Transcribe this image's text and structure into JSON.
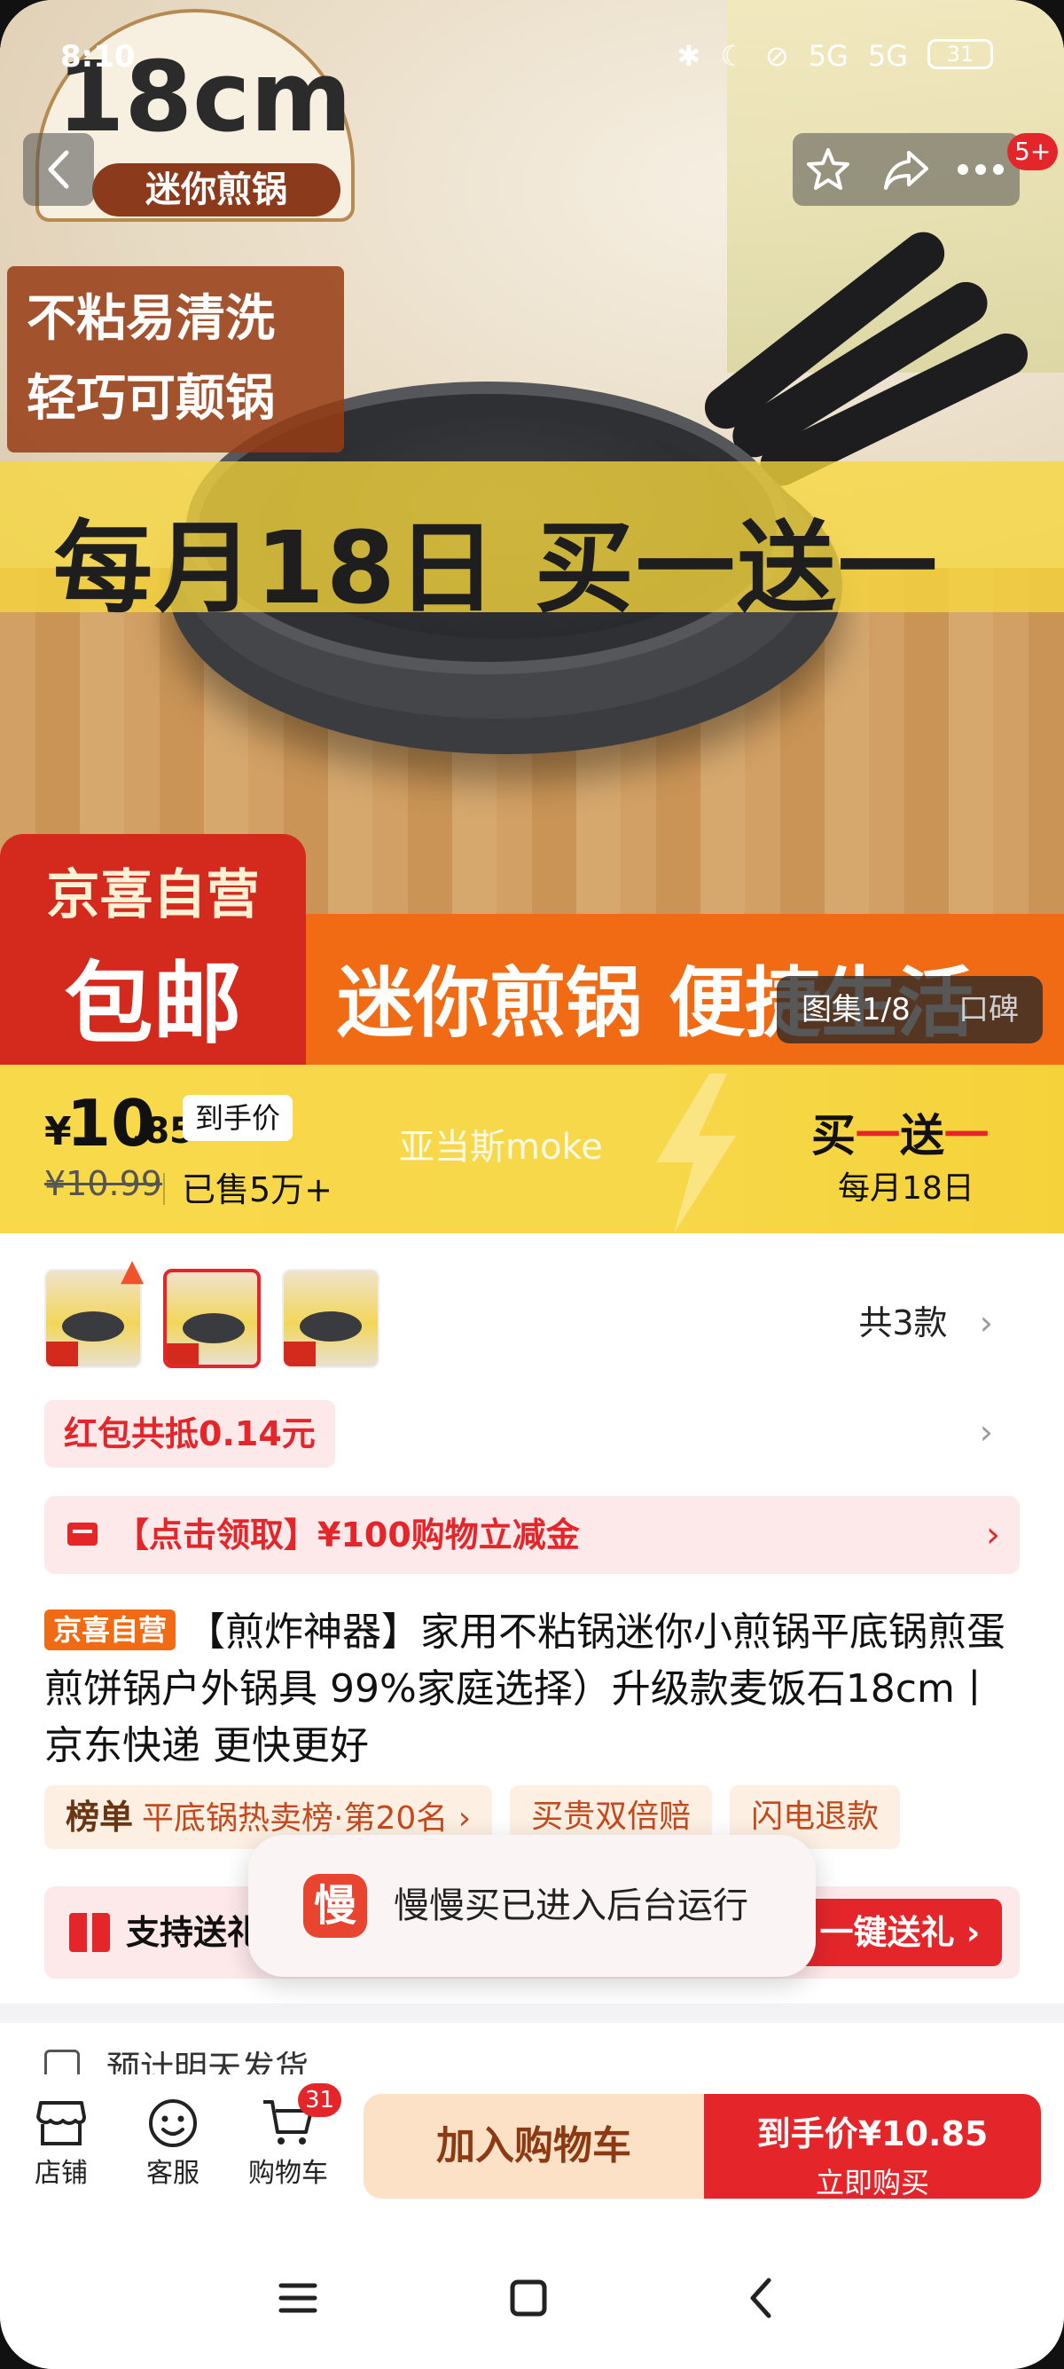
{
  "status_bar": {
    "time": "8:10",
    "signal_1": "5G",
    "signal_2": "5G",
    "battery": "31"
  },
  "hero": {
    "size_big": "18cm",
    "size_label": "迷你煎锅",
    "feature_1": "不粘易清洗",
    "feature_2": "轻巧可颠锅",
    "promo_band": "每月18日 买一送一",
    "brand_badge_1": "京喜自营",
    "brand_badge_2": "包邮",
    "orange_slogan": "迷你煎锅 便捷生活",
    "gallery_label": "图集1/8",
    "reviews_label": "口碑",
    "notification_count": "5+"
  },
  "price": {
    "currency": "¥",
    "integer": "10",
    "decimal": ".85",
    "final_price_tag": "到手价",
    "original": "¥10.99",
    "sold": "已售5万+",
    "watermark": "亚当斯moke",
    "bogo_a": "买",
    "bogo_b": "一",
    "bogo_c": "送",
    "bogo_d": "一",
    "bogo_date": "每月18日"
  },
  "variants": {
    "count_label": "共3款"
  },
  "coupon": {
    "label": "红包共抵0.14元"
  },
  "claim": {
    "label": "【点击领取】¥100购物立减金"
  },
  "product": {
    "badge": "京喜自营",
    "title": "【煎炸神器】家用不粘锅迷你小煎锅平底锅煎蛋煎饼锅户外锅具 99%家庭选择）升级款麦饭石18cm丨京东快递 更快更好"
  },
  "chips": [
    {
      "bold": "榜单",
      "text": "平底锅热卖榜·第20名 ›"
    },
    {
      "bold": "",
      "text": "买贵双倍赔"
    },
    {
      "bold": "",
      "text": "闪电退款"
    }
  ],
  "gift": {
    "label": "支持送礼",
    "button": "一键送礼 ›"
  },
  "toast": {
    "logo_char": "慢",
    "message": "慢慢买已进入后台运行"
  },
  "delivery": {
    "label": "预计明天发货"
  },
  "action_bar": {
    "store": "店铺",
    "service": "客服",
    "cart": "购物车",
    "cart_count": "31",
    "add_to_cart": "加入购物车",
    "buy_line1_prefix": "到手价",
    "buy_line1_price": "¥10.85",
    "buy_line2": "立即购买"
  },
  "colors": {
    "accent_red": "#e4262a",
    "promo_yellow": "#f8d94a",
    "brand_orange": "#f06b14"
  }
}
